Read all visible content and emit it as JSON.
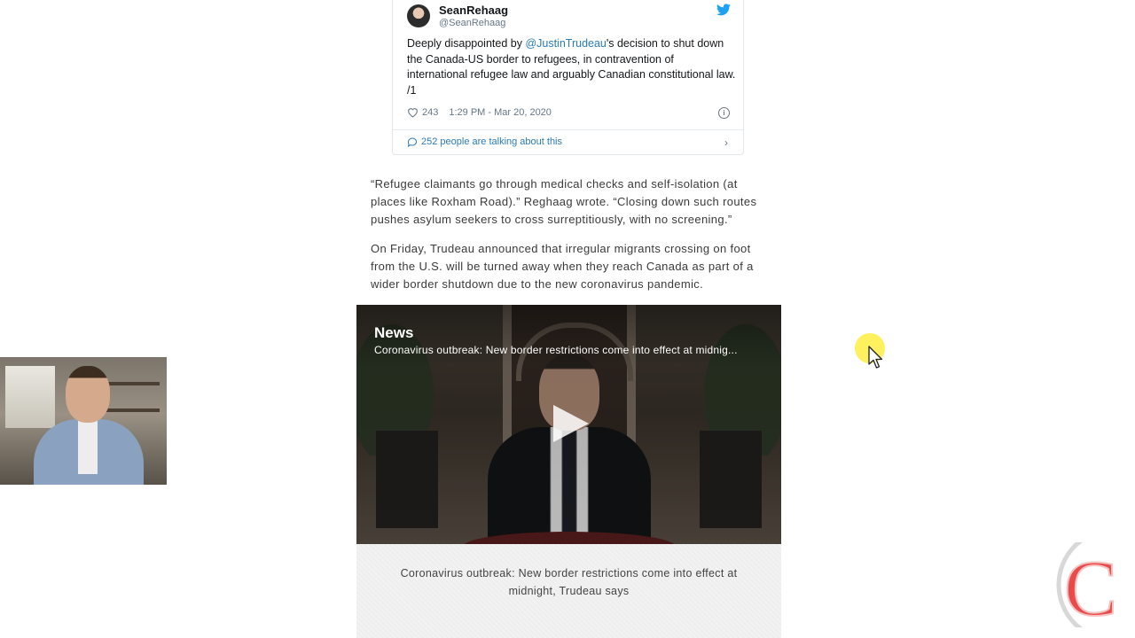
{
  "tweet": {
    "name": "SeanRehaag",
    "handle": "@SeanRehaag",
    "text_before": "Deeply disappointed by ",
    "mention": "@JustinTrudeau",
    "text_after": "'s decision to shut down the Canada-US border to refugees, in contravention of international refugee law and arguably Canadian constitutional law. /1",
    "likes": "243",
    "time": "1:29 PM - Mar 20, 2020",
    "talking": "252 people are talking about this"
  },
  "article": {
    "paragraph1": "“Refugee claimants go through medical checks and self-isolation (at places like Roxham Road).” Reghaag wrote. “Closing down such routes pushes asylum seekers to cross surreptitiously, with no screening.”",
    "paragraph2": "On Friday, Trudeau announced that irregular migrants crossing on foot from the U.S. will be turned away when they reach Canada as part of a wider border shutdown due to the new coronavirus pandemic."
  },
  "video": {
    "brand": "News",
    "title": "Coronavirus outbreak: New border restrictions come into effect at midnig...",
    "caption": "Coronavirus outbreak: New border restrictions come into effect at midnight, Trudeau says"
  },
  "logo": {
    "letter": "C"
  },
  "colors": {
    "link": "#2b7bb9",
    "twitter_blue": "#1da1f2",
    "logo_red": "#e94b4b",
    "cursor_highlight": "#ffeb28"
  },
  "icons": [
    "twitter-bird-icon",
    "heart-icon",
    "info-icon",
    "comment-bubble-icon",
    "chevron-right-icon",
    "play-icon",
    "cursor-icon"
  ]
}
